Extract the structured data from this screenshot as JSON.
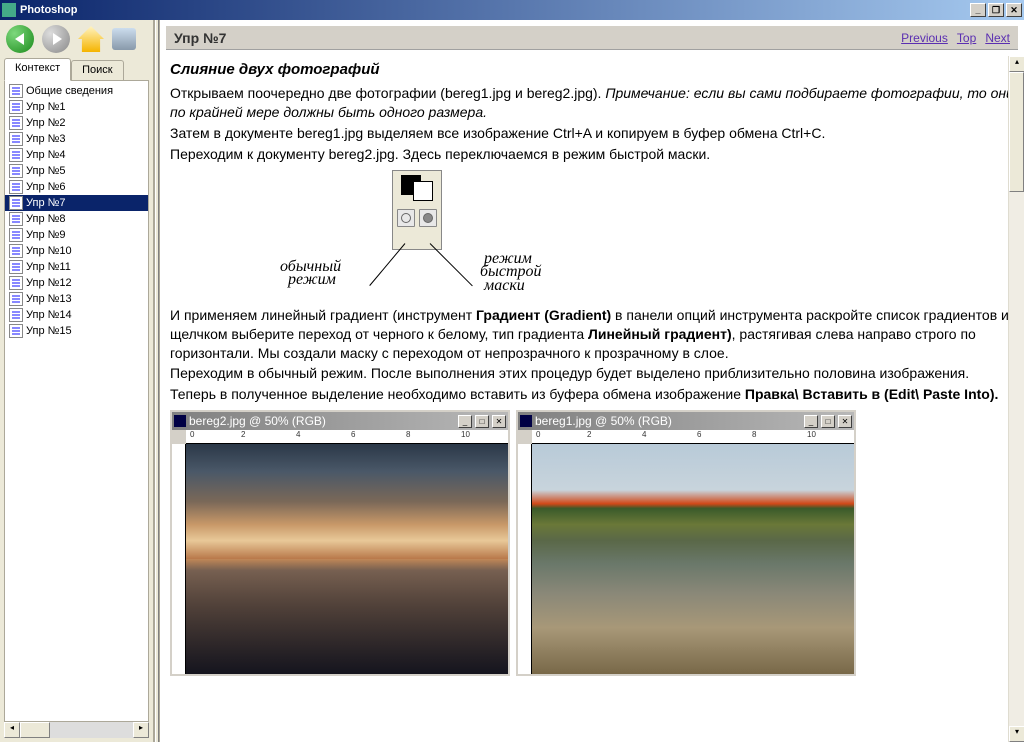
{
  "window": {
    "title": "Photoshop"
  },
  "toolbar": {
    "back": "Back",
    "forward": "Forward",
    "home": "Home",
    "print": "Print"
  },
  "tabs": {
    "context": "Контекст",
    "search": "Поиск"
  },
  "tree": [
    "Общие сведения",
    "Упр №1",
    "Упр №2",
    "Упр №3",
    "Упр №4",
    "Упр №5",
    "Упр №6",
    "Упр №7",
    "Упр №8",
    "Упр №9",
    "Упр №10",
    "Упр №11",
    "Упр №12",
    "Упр №13",
    "Упр №14",
    "Упр №15"
  ],
  "tree_selected_index": 7,
  "header": {
    "title": "Упр №7",
    "prev": "Previous",
    "top": "Top",
    "next": "Next"
  },
  "article": {
    "title": "Слияние двух фотографий",
    "p1a": "Открываем поочередно две фотографии (bereg1.jpg и bereg2.jpg). ",
    "p1b": "Примечание: если вы сами подбираете фотографии, то они по крайней мере должны быть одного размера.",
    "p2": "Затем в документе bereg1.jpg выделяем все изображение Ctrl+A и копируем в буфер обмена Ctrl+C.",
    "p3": "Переходим к документу bereg2.jpg. Здесь переключаемся в режим быстрой маски.",
    "diagram": {
      "normal_mode_l1": "обычный",
      "normal_mode_l2": "режим",
      "quick_mask_l1": "режим",
      "quick_mask_l2": "быстрой",
      "quick_mask_l3": "маски"
    },
    "p4a": "И применяем линейный градиент (инструмент ",
    "p4b": "Градиент (Gradient)",
    "p4c": " в панели опций инструмента раскройте список градиентов и щелчком выберите переход от черного к белому, тип градиента ",
    "p4d": "Линейный градиент)",
    "p4e": ", растягивая слева направо строго по горизонтали. Мы создали маску с переходом от непрозрачного к прозрачному в слое.",
    "p5": "Переходим в обычный режим. После выполнения этих процедур будет выделено приблизительно половина изображения.",
    "p6a": "Теперь в полученное выделение необходимо вставить из буфера обмена изображение ",
    "p6b": "Правка\\ Вставить в (Edit\\ Paste Into)."
  },
  "ps_windows": {
    "bereg2": "bereg2.jpg @ 50% (RGB)",
    "bereg1": "bereg1.jpg @ 50% (RGB)"
  }
}
